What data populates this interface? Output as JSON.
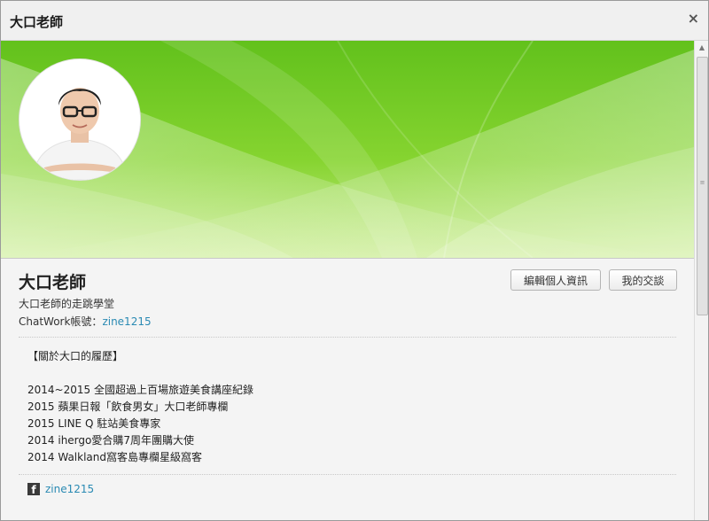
{
  "dialog": {
    "title": "大口老師",
    "close_symbol": "×"
  },
  "cover": {
    "accent_color": "#7fd12a",
    "avatar": "profile-photo"
  },
  "profile": {
    "name": "大口老師",
    "subtitle": "大口老師的走跳學堂",
    "chatwork_label": "ChatWork帳號：",
    "chatwork_id": "zine1215",
    "edit_button": "編輯個人資訊",
    "chat_button": "我的交談"
  },
  "bio": {
    "heading": "【關於大口的履歷】",
    "lines": [
      "2014~2015 全國超過上百場旅遊美食講座紀錄",
      "2015 蘋果日報「飲食男女」大口老師專欄",
      "2015 LINE Q 駐站美食專家",
      "2014 ihergo愛合購7周年團購大使",
      "2014 Walkland窩客島專欄星級窩客"
    ]
  },
  "social": {
    "facebook_icon": "facebook-icon",
    "facebook_glyph": "f",
    "facebook_handle": "zine1215"
  },
  "colors": {
    "link": "#2a8ab3",
    "cover_green": "#7fd12a"
  }
}
